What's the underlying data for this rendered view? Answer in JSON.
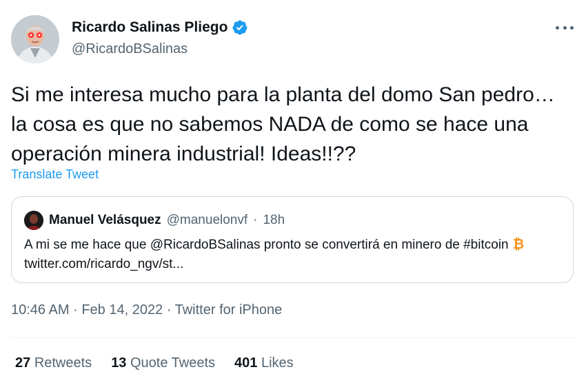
{
  "author": {
    "name": "Ricardo Salinas Pliego",
    "handle": "@RicardoBSalinas",
    "verified": true
  },
  "tweet": {
    "text": "Si me interesa mucho para la planta del domo San pedro…la cosa es que no sabemos NADA de como se hace una operación minera industrial! Ideas!!??",
    "translate_label": "Translate Tweet"
  },
  "quote": {
    "name": "Manuel Velásquez",
    "handle": "@manuelonvf",
    "separator": "·",
    "time": "18h",
    "text_before": "A mi se me hace que @RicardoBSalinas pronto se convertirá en minero de #bitcoin",
    "link": "twitter.com/ricardo_ngv/st..."
  },
  "meta": {
    "time": "10:46 AM",
    "sep1": "·",
    "date": "Feb 14, 2022",
    "sep2": "·",
    "source": "Twitter for iPhone"
  },
  "stats": {
    "retweets_count": "27",
    "retweets_label": "Retweets",
    "quotes_count": "13",
    "quotes_label": "Quote Tweets",
    "likes_count": "401",
    "likes_label": "Likes"
  },
  "colors": {
    "accent": "#1d9bf0",
    "secondary_text": "#536471",
    "border": "#cfd9de",
    "bitcoin": "#f7931a"
  },
  "icons": {
    "verified": "verified-badge-icon",
    "more": "more-options-icon",
    "bitcoin": "bitcoin-emoji-icon"
  }
}
